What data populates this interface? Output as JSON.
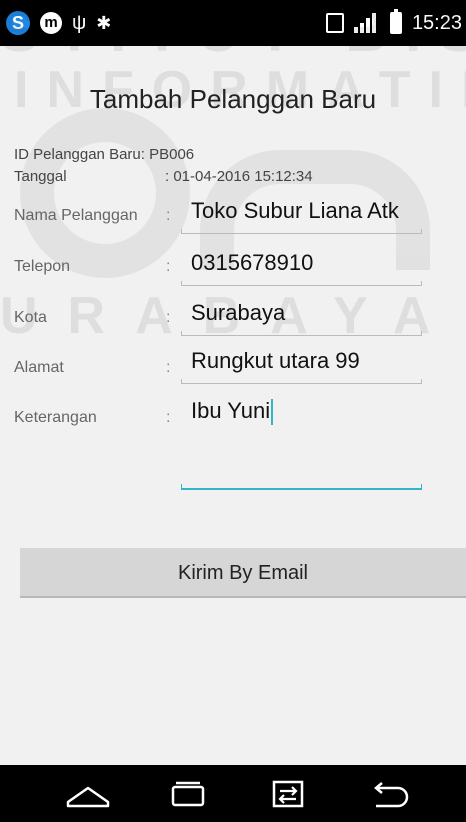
{
  "status_bar": {
    "time": "15:23",
    "left_icons": [
      "s-app-icon",
      "m-app-icon",
      "usb-icon",
      "bug-icon"
    ],
    "right_icons": [
      "tablet-icon",
      "signal-icon",
      "battery-icon"
    ]
  },
  "watermark": {
    "line1": "STITUT BISNIS",
    "line2": "INFORMATIKA",
    "line3": "URABAYA"
  },
  "form": {
    "title": "Tambah Pelanggan Baru",
    "id_label": "ID Pelanggan Baru",
    "id_value": ": PB006",
    "date_label": "Tanggal",
    "date_value": ": 01-04-2016 15:12:34",
    "colon": ":",
    "fields": [
      {
        "label": "Nama Pelanggan",
        "value": "Toko Subur Liana Atk"
      },
      {
        "label": "Telepon",
        "value": "0315678910"
      },
      {
        "label": "Kota",
        "value": "Surabaya"
      },
      {
        "label": "Alamat",
        "value": "Rungkut utara 99"
      },
      {
        "label": "Keterangan",
        "value": "Ibu Yuni"
      }
    ],
    "submit_label": "Kirim By Email"
  },
  "navbar": {
    "icons": [
      "home-icon",
      "recent-apps-icon",
      "switch-icon",
      "back-icon"
    ]
  },
  "colors": {
    "accent": "#33b5c8",
    "button_bg": "#d6d6d6",
    "background": "#f1f1f1"
  }
}
